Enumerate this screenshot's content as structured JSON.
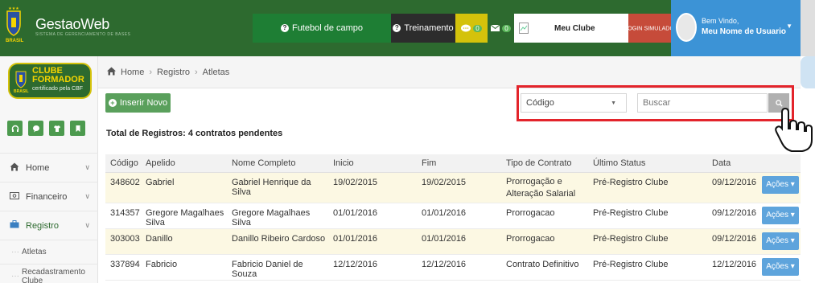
{
  "header": {
    "app_title": "GestaoWeb",
    "app_subtitle": "SISTEMA DE GERENCIAMENTO DE BASES",
    "brand_text": "BRASIL",
    "futebol_label": "Futebol de campo",
    "treinamento_label": "Treinamento",
    "chat_count": "0",
    "mail_count": "0",
    "clube_label": "Meu Clube",
    "login_label": "LOGIN SIMULADO",
    "welcome": "Bem Vindo,",
    "username": "Meu Nome de Usuario"
  },
  "sidebar": {
    "logo_line1": "CLUBE",
    "logo_line2": "FORMADOR",
    "logo_line3": "certificado pela CBF",
    "logo_brand": "BRASIL",
    "items": [
      {
        "label": "Home"
      },
      {
        "label": "Financeiro"
      },
      {
        "label": "Registro"
      }
    ],
    "subitems": [
      {
        "label": "Atletas"
      },
      {
        "label": "Recadastramento Clube"
      }
    ]
  },
  "breadcrumb": {
    "home": "Home",
    "registro": "Registro",
    "atletas": "Atletas"
  },
  "toolbar": {
    "new_label": "Inserir Novo",
    "filter_value": "Código",
    "search_placeholder": "Buscar"
  },
  "summary": {
    "total_text": "Total de Registros: 4 contratos pendentes"
  },
  "table": {
    "headers": [
      "Código",
      "Apelido",
      "Nome Completo",
      "Inicio",
      "Fim",
      "Tipo de Contrato",
      "Último Status",
      "Data"
    ],
    "action_label": "Ações",
    "rows": [
      {
        "codigo": "348602",
        "apelido": "Gabriel",
        "nome": "Gabriel Henrique da Silva",
        "inicio": "19/02/2015",
        "fim": "19/02/2015",
        "tipo": "Prorrogação e Alteração Salarial",
        "status": "Pré-Registro Clube",
        "data": "09/12/2016"
      },
      {
        "codigo": "314357",
        "apelido": "Gregore Magalhaes Silva",
        "nome": "Gregore Magalhaes Silva",
        "inicio": "01/01/2016",
        "fim": "01/01/2016",
        "tipo": "Prorrogacao",
        "status": "Pré-Registro Clube",
        "data": "09/12/2016"
      },
      {
        "codigo": "303003",
        "apelido": "Danillo",
        "nome": "Danillo Ribeiro Cardoso",
        "inicio": "01/01/2016",
        "fim": "01/01/2016",
        "tipo": "Prorrogacao",
        "status": "Pré-Registro Clube",
        "data": "09/12/2016"
      },
      {
        "codigo": "337894",
        "apelido": "Fabricio",
        "nome": "Fabricio Daniel de Souza",
        "inicio": "12/12/2016",
        "fim": "12/12/2016",
        "tipo": "Contrato Definitivo",
        "status": "Pré-Registro Clube",
        "data": "12/12/2016"
      }
    ]
  },
  "colors": {
    "topbar": "#2d6a2f",
    "accent_green": "#5aa05c",
    "highlight_red": "#e3242b",
    "action_blue": "#5ea4dc",
    "row_highlight": "#fcf8e3"
  }
}
